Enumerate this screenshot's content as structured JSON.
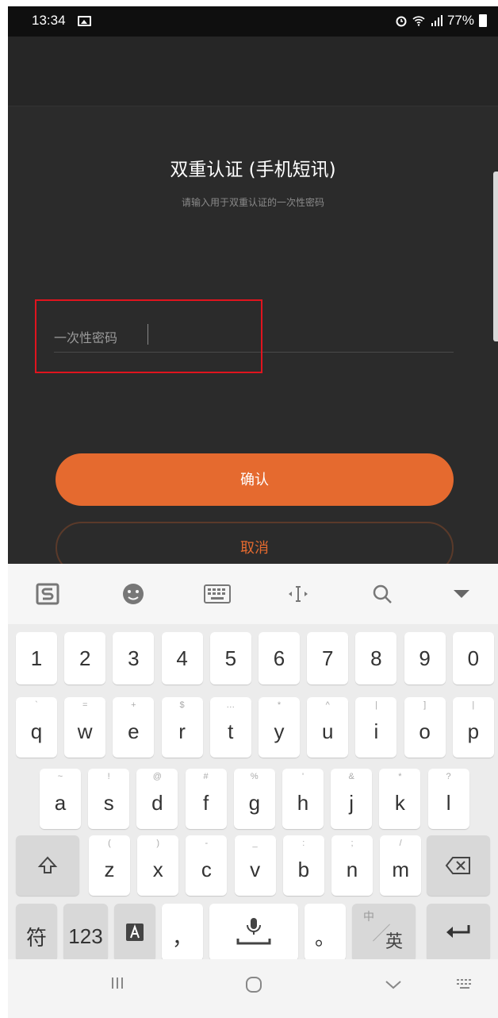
{
  "status_bar": {
    "time": "13:34",
    "battery": "77%"
  },
  "app": {
    "title": "双重认证 (手机短讯)",
    "subtitle": "请输入用于双重认证的一次性密码",
    "otp_placeholder": "一次性密码",
    "confirm_label": "确认",
    "cancel_label": "取消",
    "accent_color": "#e56a2f"
  },
  "keyboard": {
    "toolbar_icons": [
      "sogou-logo-icon",
      "emoji-icon",
      "keyboard-icon",
      "cursor-move-icon",
      "search-icon",
      "collapse-icon"
    ],
    "number_row": [
      "1",
      "2",
      "3",
      "4",
      "5",
      "6",
      "7",
      "8",
      "9",
      "0"
    ],
    "row1": [
      {
        "key": "q",
        "hint": "`"
      },
      {
        "key": "w",
        "hint": "="
      },
      {
        "key": "e",
        "hint": "+"
      },
      {
        "key": "r",
        "hint": "$"
      },
      {
        "key": "t",
        "hint": "…"
      },
      {
        "key": "y",
        "hint": "*"
      },
      {
        "key": "u",
        "hint": "^"
      },
      {
        "key": "i",
        "hint": "|"
      },
      {
        "key": "o",
        "hint": "]"
      },
      {
        "key": "p",
        "hint": "|"
      }
    ],
    "row2": [
      {
        "key": "a",
        "hint": "~"
      },
      {
        "key": "s",
        "hint": "!"
      },
      {
        "key": "d",
        "hint": "@"
      },
      {
        "key": "f",
        "hint": "#"
      },
      {
        "key": "g",
        "hint": "%"
      },
      {
        "key": "h",
        "hint": "'"
      },
      {
        "key": "j",
        "hint": "&"
      },
      {
        "key": "k",
        "hint": "*"
      },
      {
        "key": "l",
        "hint": "?"
      }
    ],
    "row3": [
      {
        "key": "z",
        "hint": "("
      },
      {
        "key": "x",
        "hint": ")"
      },
      {
        "key": "c",
        "hint": "-"
      },
      {
        "key": "v",
        "hint": "_"
      },
      {
        "key": "b",
        "hint": ":"
      },
      {
        "key": "n",
        "hint": ";"
      },
      {
        "key": "m",
        "hint": "/"
      }
    ],
    "symbol_key": "符",
    "numeric_key": "123",
    "comma_key": "，",
    "period_key": "。",
    "lang_key_top": "中",
    "lang_key_main": "英"
  }
}
